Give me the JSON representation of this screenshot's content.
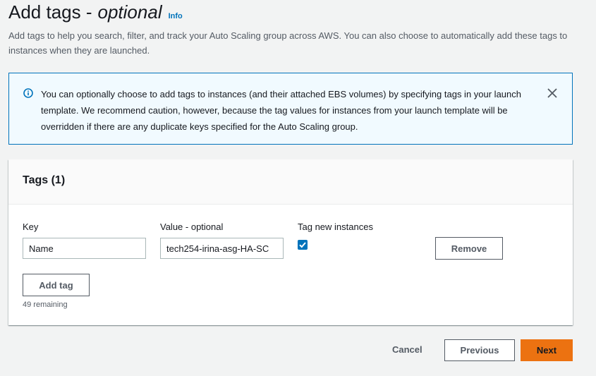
{
  "header": {
    "title_main": "Add tags -",
    "title_optional": "optional",
    "info_label": "Info",
    "description": "Add tags to help you search, filter, and track your Auto Scaling group across AWS. You can also choose to automatically add these tags to instances when they are launched."
  },
  "alert": {
    "message": "You can optionally choose to add tags to instances (and their attached EBS volumes) by specifying tags in your launch template. We recommend caution, however, because the tag values for instances from your launch template will be overridden if there are any duplicate keys specified for the Auto Scaling group.",
    "icon": "info-circle-icon",
    "close_icon": "close-icon"
  },
  "tags_panel": {
    "title": "Tags (1)",
    "key_label": "Key",
    "value_label": "Value - optional",
    "tag_new_instances_label": "Tag new instances",
    "rows": [
      {
        "key": "Name",
        "value": "tech254-irina-asg-HA-SC",
        "tag_new_instances": true
      }
    ],
    "remove_label": "Remove",
    "add_tag_label": "Add tag",
    "remaining": "49 remaining"
  },
  "footer": {
    "cancel_label": "Cancel",
    "previous_label": "Previous",
    "next_label": "Next"
  },
  "colors": {
    "link": "#0073bb",
    "alert_border": "#0073bb",
    "alert_bg": "#f1faff",
    "primary_button": "#ec7211",
    "checkbox": "#0073bb"
  }
}
